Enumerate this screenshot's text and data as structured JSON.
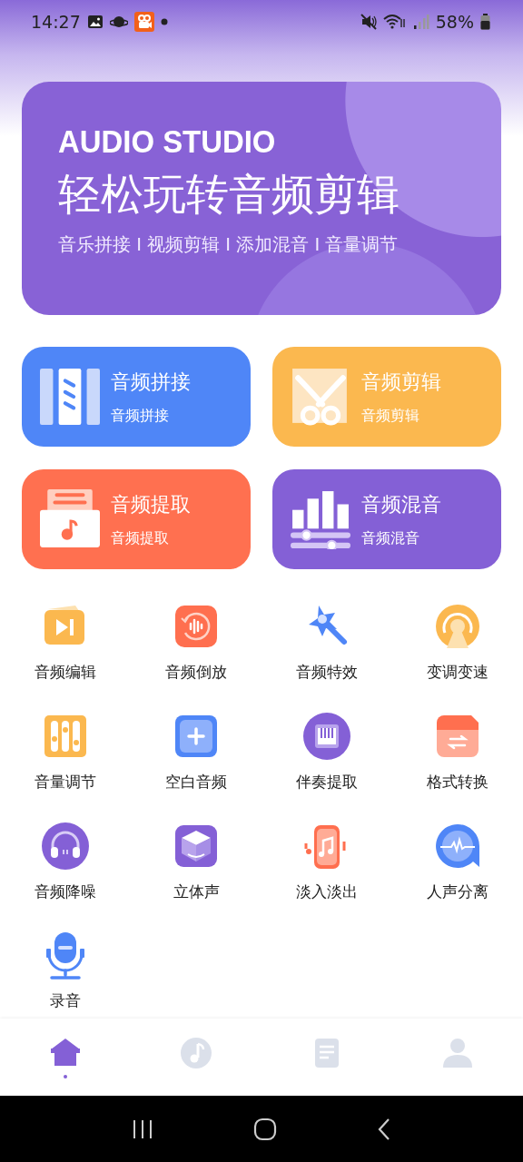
{
  "status_bar": {
    "time": "14:27",
    "battery": "58%"
  },
  "banner": {
    "title": "AUDIO STUDIO",
    "headline": "轻松玩转音频剪辑",
    "subtitle": "音乐拼接 I 视频剪辑 I 添加混音 I 音量调节"
  },
  "feature_cards": [
    {
      "kind": "splice",
      "title": "音频拼接",
      "subtitle": "音频拼接",
      "color": "#4f86f7"
    },
    {
      "kind": "cut",
      "title": "音频剪辑",
      "subtitle": "音频剪辑",
      "color": "#fbb84f"
    },
    {
      "kind": "extract",
      "title": "音频提取",
      "subtitle": "音频提取",
      "color": "#ff7050"
    },
    {
      "kind": "mix",
      "title": "音频混音",
      "subtitle": "音频混音",
      "color": "#8460d6"
    }
  ],
  "tools": [
    {
      "kind": "edit",
      "label": "音频编辑"
    },
    {
      "kind": "reverse",
      "label": "音频倒放"
    },
    {
      "kind": "effects",
      "label": "音频特效"
    },
    {
      "kind": "pitch",
      "label": "变调变速"
    },
    {
      "kind": "volume",
      "label": "音量调节"
    },
    {
      "kind": "blank",
      "label": "空白音频"
    },
    {
      "kind": "accompany",
      "label": "伴奏提取"
    },
    {
      "kind": "convert",
      "label": "格式转换"
    },
    {
      "kind": "denoise",
      "label": "音频降噪"
    },
    {
      "kind": "stereo",
      "label": "立体声"
    },
    {
      "kind": "fade",
      "label": "淡入淡出"
    },
    {
      "kind": "vocal",
      "label": "人声分离"
    },
    {
      "kind": "record",
      "label": "录音"
    }
  ],
  "tab_bar": [
    {
      "kind": "home",
      "selected": true
    },
    {
      "kind": "music",
      "selected": false
    },
    {
      "kind": "docs",
      "selected": false
    },
    {
      "kind": "profile",
      "selected": false
    }
  ]
}
